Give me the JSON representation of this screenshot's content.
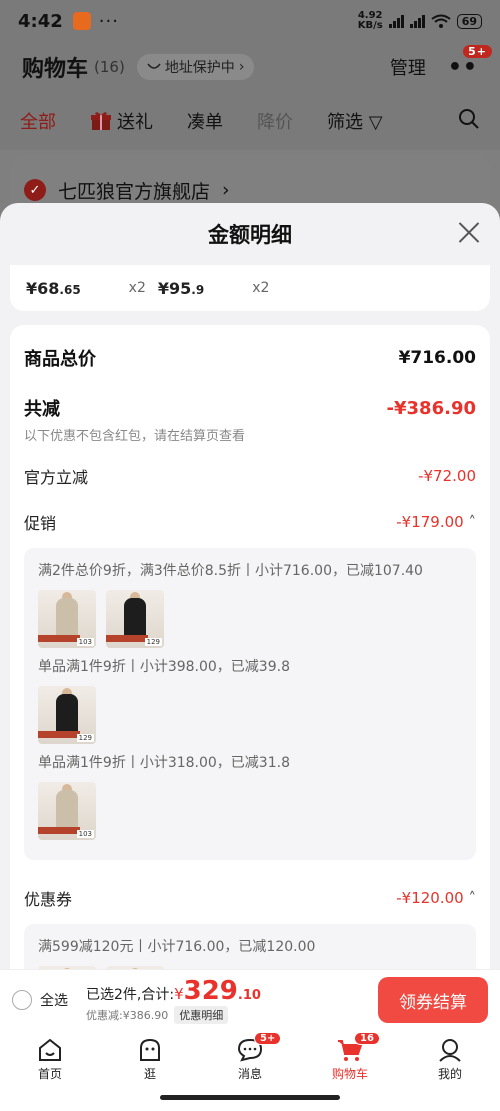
{
  "status": {
    "time": "4:42",
    "net_speed_top": "4.92",
    "net_speed_unit": "KB/s",
    "battery": "69"
  },
  "header": {
    "title": "购物车",
    "count": "(16)",
    "address_protect": "地址保护中",
    "manage": "管理",
    "more_badge": "5+"
  },
  "filters": {
    "all": "全部",
    "gift": "送礼",
    "combine": "凑单",
    "price_drop": "降价",
    "filter": "筛选"
  },
  "store": {
    "name": "七匹狼官方旗舰店"
  },
  "sheet": {
    "title": "金额明细",
    "items": [
      {
        "price_int": "¥68",
        "price_dec": ".65",
        "qty": "x2"
      },
      {
        "price_int": "¥95",
        "price_dec": ".9",
        "qty": "x2"
      }
    ],
    "total_label": "商品总价",
    "total_value": "¥716.00",
    "reduce_label": "共减",
    "reduce_value": "-¥386.90",
    "reduce_hint": "以下优惠不包含红包，请在结算页查看",
    "official_label": "官方立减",
    "official_value": "-¥72.00",
    "promo_label": "促销",
    "promo_value": "-¥179.00",
    "promo_box": {
      "line1": "满2件总价9折，满3件总价8.5折丨小计716.00，已减107.40",
      "line2": "单品满1件9折丨小计398.00，已减39.8",
      "line3": "单品满1件9折丨小计318.00，已减31.8",
      "thumb_tags": [
        "103",
        "129",
        "129",
        "103"
      ]
    },
    "coupon_label": "优惠券",
    "coupon_value": "-¥120.00",
    "coupon_line": "满599减120元丨小计716.00，已减120.00"
  },
  "checkout": {
    "select_all": "全选",
    "selected_text": "已选2件,合计:",
    "currency": "¥",
    "amount_int": "329",
    "amount_dec": ".10",
    "discount_text": "优惠减:¥386.90",
    "detail_button": "优惠明细",
    "pay_button": "领券结算"
  },
  "tabbar": {
    "home": "首页",
    "browse": "逛",
    "messages": "消息",
    "messages_badge": "5+",
    "cart": "购物车",
    "cart_badge": "16",
    "mine": "我的"
  }
}
